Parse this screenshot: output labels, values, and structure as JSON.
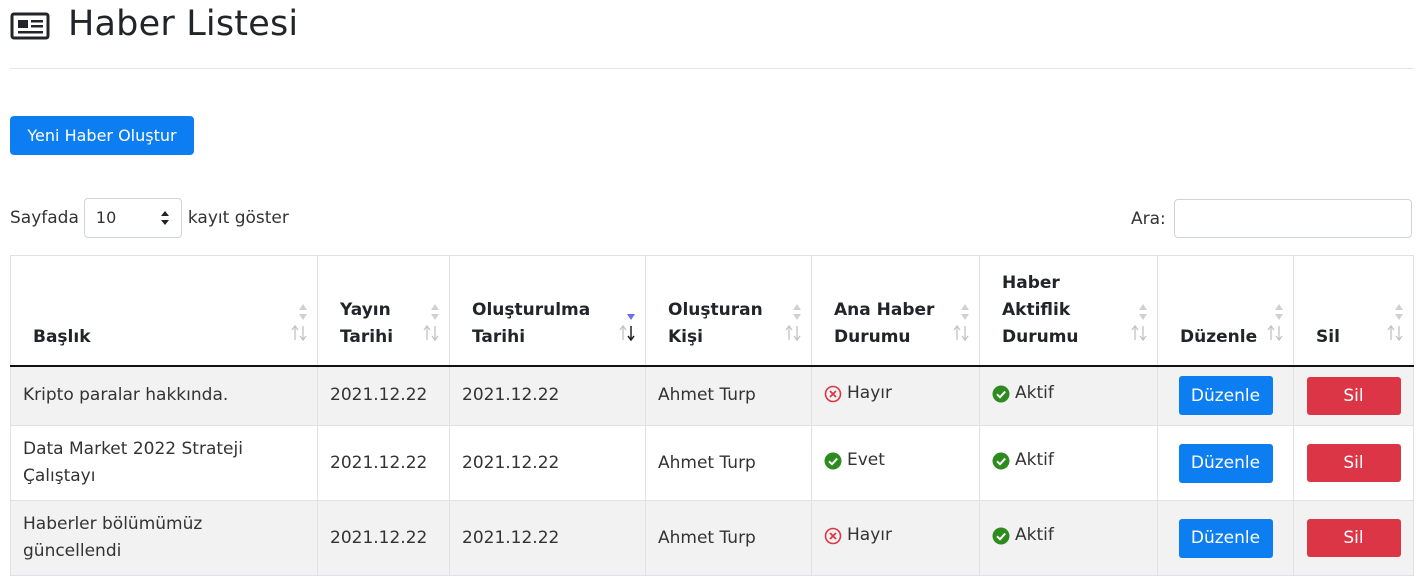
{
  "header": {
    "title": "Haber Listesi",
    "icon": "newspaper-icon"
  },
  "toolbar": {
    "new_button_label": "Yeni Haber Oluştur"
  },
  "length_control": {
    "prefix": "Sayfada",
    "selected": "10",
    "suffix": "kayıt göster"
  },
  "search": {
    "label": "Ara:",
    "value": ""
  },
  "table": {
    "columns": [
      {
        "label": "Başlık"
      },
      {
        "label": "Yayın Tarihi"
      },
      {
        "label": "Oluşturulma Tarihi",
        "sorted": "descending"
      },
      {
        "label": "Oluşturan Kişi"
      },
      {
        "label": "Ana Haber Durumu"
      },
      {
        "label": "Haber Aktiflik Durumu"
      },
      {
        "label": "Düzenle"
      },
      {
        "label": "Sil"
      }
    ],
    "rows": [
      {
        "title": "Kripto paralar hakkında.",
        "publish_date": "2021.12.22",
        "created_date": "2021.12.22",
        "author": "Ahmet Turp",
        "headline": {
          "text": "Hayır",
          "icon": "x-circle-icon"
        },
        "active": {
          "text": "Aktif",
          "icon": "check-circle-icon"
        },
        "edit_label": "Düzenle",
        "delete_label": "Sil"
      },
      {
        "title": "Data Market 2022 Strateji Çalıştayı",
        "publish_date": "2021.12.22",
        "created_date": "2021.12.22",
        "author": "Ahmet Turp",
        "headline": {
          "text": "Evet",
          "icon": "check-circle-icon"
        },
        "active": {
          "text": "Aktif",
          "icon": "check-circle-icon"
        },
        "edit_label": "Düzenle",
        "delete_label": "Sil"
      },
      {
        "title": "Haberler bölümümüz güncellendi",
        "publish_date": "2021.12.22",
        "created_date": "2021.12.22",
        "author": "Ahmet Turp",
        "headline": {
          "text": "Hayır",
          "icon": "x-circle-icon"
        },
        "active": {
          "text": "Aktif",
          "icon": "check-circle-icon"
        },
        "edit_label": "Düzenle",
        "delete_label": "Sil"
      }
    ]
  },
  "colors": {
    "primary": "#0d7ef2",
    "danger": "#dc3545",
    "success": "#2e8b1f",
    "error": "#dc3545",
    "sort_active": "#6c6cf0"
  }
}
